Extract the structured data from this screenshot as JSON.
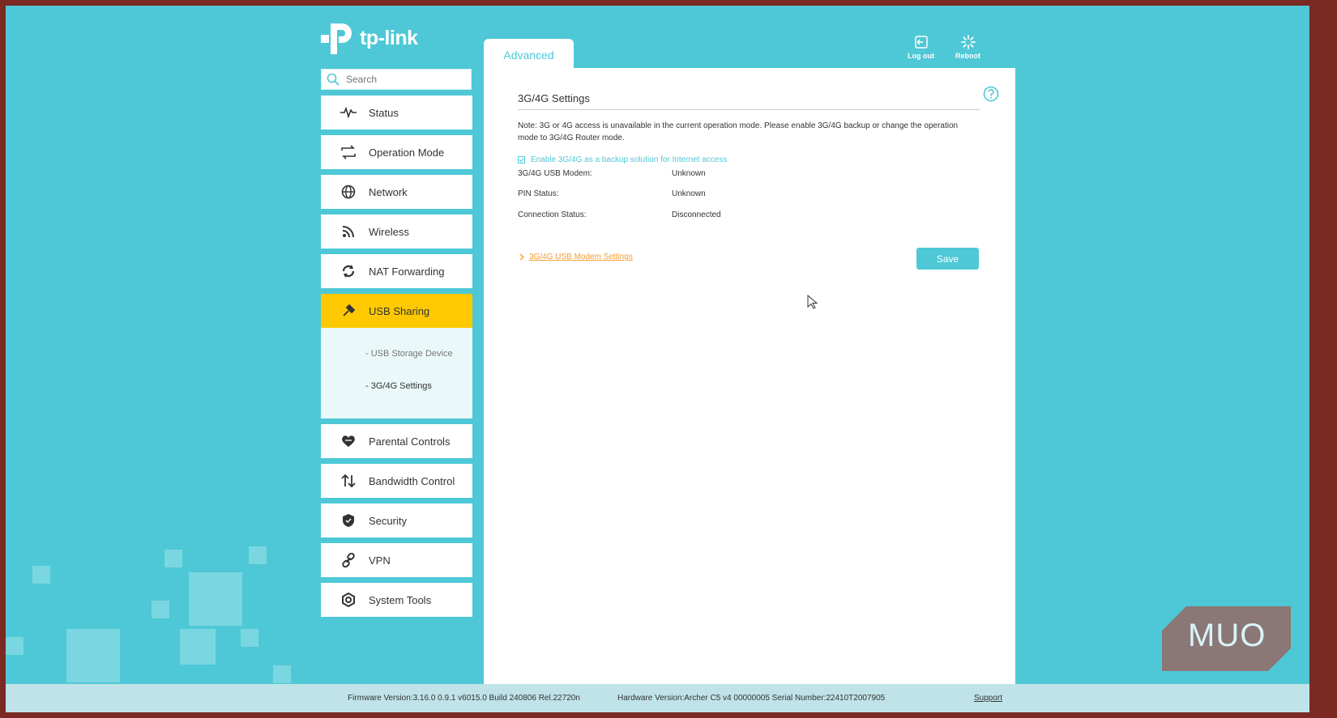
{
  "brand": {
    "logo_text": "tp-link"
  },
  "search": {
    "placeholder": "Search"
  },
  "tabs": {
    "advanced": "Advanced"
  },
  "top_actions": {
    "logout": "Log out",
    "reboot": "Reboot"
  },
  "menu": {
    "status": "Status",
    "operation_mode": "Operation Mode",
    "network": "Network",
    "wireless": "Wireless",
    "nat_forwarding": "NAT Forwarding",
    "usb_sharing": "USB Sharing",
    "usb_storage_device": "- USB Storage Device",
    "g34_settings": "- 3G/4G Settings",
    "parental_controls": "Parental Controls",
    "bandwidth_control": "Bandwidth Control",
    "security": "Security",
    "vpn": "VPN",
    "system_tools": "System Tools"
  },
  "content": {
    "title": "3G/4G Settings",
    "note": "Note: 3G or 4G access is unavailable in the current operation mode. Please enable 3G/4G backup or change the operation mode to 3G/4G Router mode.",
    "backup_checkbox_label": "Enable 3G/4G as a backup solution for Internet access",
    "fields": [
      {
        "label": "3G/4G USB Modem:",
        "value": "Unknown"
      },
      {
        "label": "PIN Status:",
        "value": "Unknown"
      },
      {
        "label": "Connection Status:",
        "value": "Disconnected"
      }
    ],
    "modem_settings_link": "3G/4G USB Modem Settings",
    "save_label": "Save"
  },
  "footer": {
    "firmware": "Firmware Version:3.16.0 0.9.1 v6015.0 Build 240806 Rel.22720n",
    "hardware": "Hardware Version:Archer C5 v4 00000005 Serial Number:22410T2007905",
    "support": "Support"
  },
  "watermark": {
    "text": "MUO"
  },
  "colors": {
    "accent": "#4ec8d6",
    "active": "#fec900",
    "link": "#f39c2e"
  }
}
